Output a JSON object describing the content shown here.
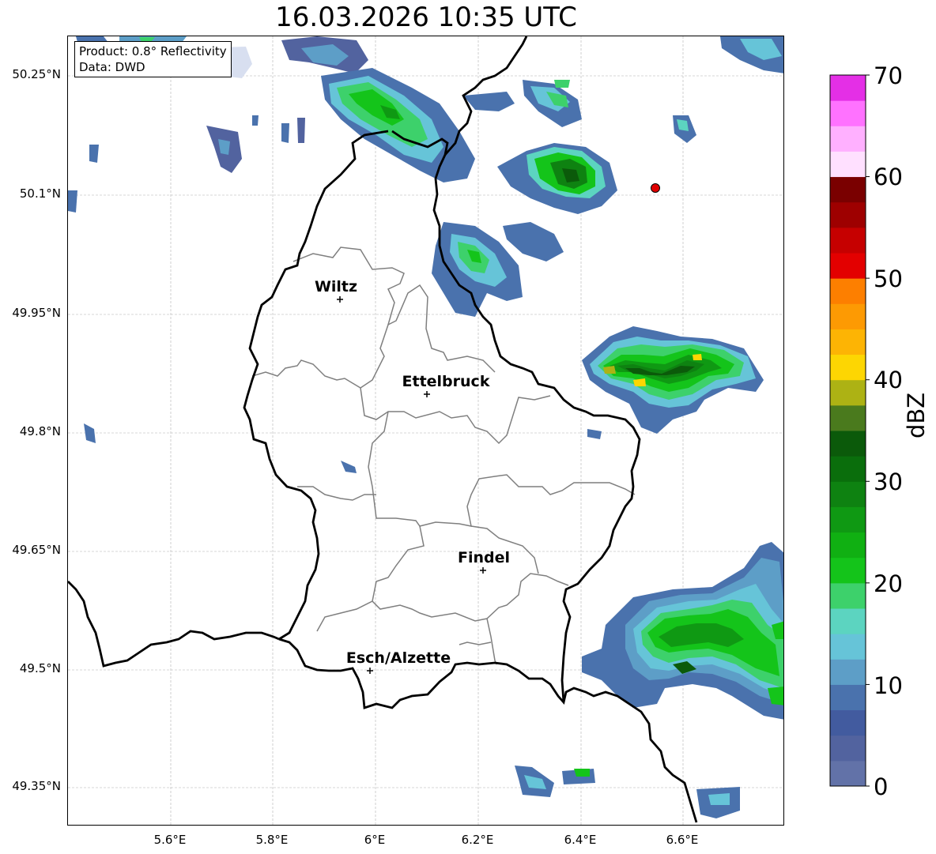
{
  "title": "16.03.2026 10:35 UTC",
  "info_box": {
    "line1": "Product: 0.8° Reflectivity",
    "line2": "Data: DWD"
  },
  "axes": {
    "lat_ticks": [
      "50.25°N",
      "50.1°N",
      "49.95°N",
      "49.8°N",
      "49.65°N",
      "49.5°N",
      "49.35°N"
    ],
    "lon_ticks": [
      "5.6°E",
      "5.8°E",
      "6°E",
      "6.2°E",
      "6.4°E",
      "6.6°E"
    ]
  },
  "colorbar": {
    "label": "dBZ",
    "tick_labels": [
      "0",
      "10",
      "20",
      "30",
      "40",
      "50",
      "60",
      "70"
    ],
    "colors": [
      "#6272a8",
      "#52639f",
      "#425b9f",
      "#4a72ad",
      "#5d9ec7",
      "#66c4d8",
      "#5cd4c0",
      "#3dd16b",
      "#14c41a",
      "#10b012",
      "#0f9913",
      "#0e8211",
      "#0a6e0c",
      "#0b5a0a",
      "#4a7a1d",
      "#adb214",
      "#fdd602",
      "#fdb404",
      "#fd9a03",
      "#fd7f00",
      "#e30000",
      "#c60000",
      "#9e0000",
      "#7a0000",
      "#ffe0ff",
      "#ffb0ff",
      "#ff72ff",
      "#e42fe6"
    ]
  },
  "map": {
    "cities": [
      {
        "name": "Wiltz"
      },
      {
        "name": "Ettelbruck"
      },
      {
        "name": "Findel"
      },
      {
        "name": "Esch/Alzette"
      }
    ],
    "radar_site_marker": "red-circle-icon"
  }
}
